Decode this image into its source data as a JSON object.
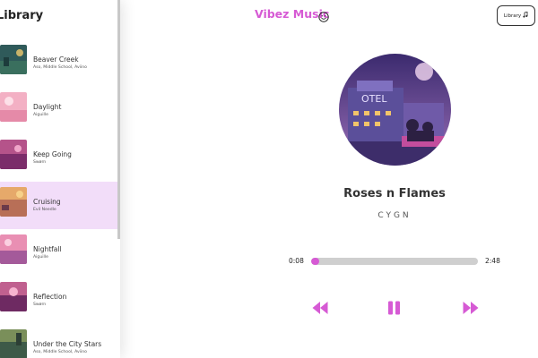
{
  "colors": {
    "accent": "#d65ad4",
    "active_row": "#f2ddf9",
    "progress_track": "#cfcfcf"
  },
  "sidebar": {
    "title": "Library",
    "songs": [
      {
        "name": "Beaver Creek",
        "artist": "Aso, Middle School, Aviino",
        "active": false
      },
      {
        "name": "Daylight",
        "artist": "Aiguille",
        "active": false
      },
      {
        "name": "Keep Going",
        "artist": "Swørn",
        "active": false
      },
      {
        "name": "Cruising",
        "artist": "Evil Needle",
        "active": true
      },
      {
        "name": "Nightfall",
        "artist": "Aiguille",
        "active": false
      },
      {
        "name": "Reflection",
        "artist": "Swørn",
        "active": false
      },
      {
        "name": "Under the City Stars",
        "artist": "Aso, Middle School, Aviino",
        "active": false
      }
    ]
  },
  "header": {
    "app_title": "Vibez Music",
    "title_icon": "smile-icon",
    "library_button_label": "Library",
    "library_button_icon": "music-note-icon"
  },
  "player": {
    "track_title": "Roses n Flames",
    "track_artist": "CYGN",
    "current_time": "0:08",
    "total_time": "2:48",
    "progress_fraction": 0.05,
    "controls": [
      "skip-back-icon",
      "pause-icon",
      "skip-forward-icon"
    ]
  }
}
